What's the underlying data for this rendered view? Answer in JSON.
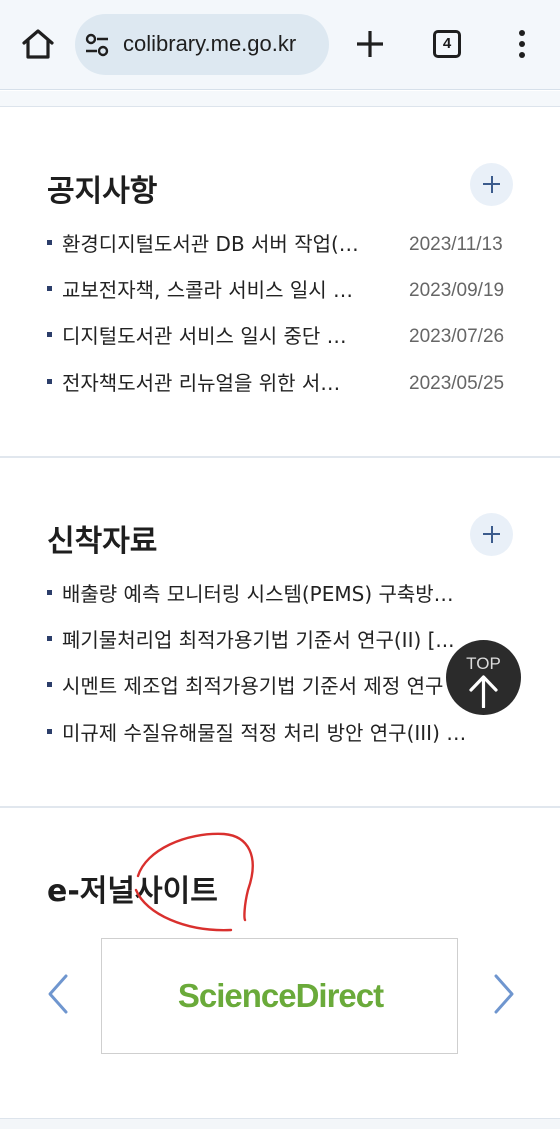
{
  "browser": {
    "url": "colibrary.me.go.kr",
    "tab_count": "4"
  },
  "notices": {
    "title": "공지사항",
    "items": [
      {
        "text": "환경디지털도서관 DB 서버 작업(…",
        "date": "2023/11/13"
      },
      {
        "text": "교보전자책, 스콜라 서비스 일시 …",
        "date": "2023/09/19"
      },
      {
        "text": "디지털도서관 서비스 일시 중단 …",
        "date": "2023/07/26"
      },
      {
        "text": "전자책도서관 리뉴얼을 위한 서…",
        "date": "2023/05/25"
      }
    ]
  },
  "new_materials": {
    "title": "신착자료",
    "items": [
      {
        "text": "배출량 예측 모니터링 시스템(PEMS) 구축방…"
      },
      {
        "text": "폐기물처리업 최적가용기법 기준서 연구(II) [..."
      },
      {
        "text": "시멘트 제조업 최적가용기법 기준서 제정 연구"
      },
      {
        "text": "미규제 수질유해물질 적정 처리 방안 연구(III) …"
      }
    ]
  },
  "top_button": {
    "label": "TOP"
  },
  "ejournal": {
    "title": "e-저널사이트",
    "banner_text": "ScienceDirect"
  },
  "colors": {
    "accent": "#3b5b8c",
    "logo_green": "#6aaa3a",
    "annotation_red": "#d9302e"
  }
}
